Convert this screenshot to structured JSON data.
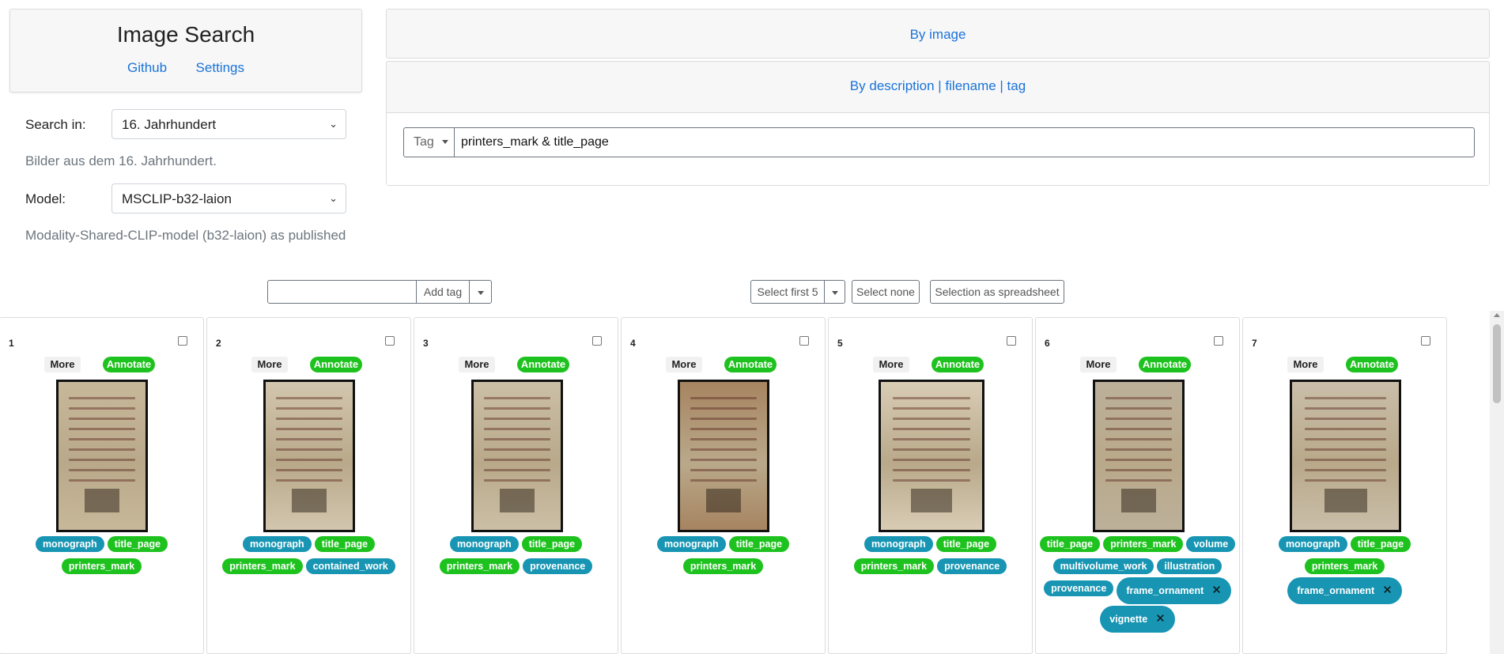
{
  "sidebar": {
    "title": "Image Search",
    "links": [
      "Github",
      "Settings"
    ],
    "search_in_label": "Search in:",
    "search_in_value": "16. Jahrhundert",
    "search_in_desc": "Bilder aus dem 16. Jahrhundert.",
    "model_label": "Model:",
    "model_value": "MSCLIP-b32-laion",
    "model_desc": "Modality-Shared-CLIP-model (b32-laion) as published"
  },
  "search": {
    "by_image": "By image",
    "by_desc": "By description | filename | tag",
    "mode": "Tag",
    "query": "printers_mark & title_page"
  },
  "toolbar": {
    "add_tag": "Add tag",
    "select_first": "Select first 5",
    "select_none": "Select none",
    "spreadsheet": "Selection as spreadsheet"
  },
  "result_buttons": {
    "more": "More",
    "annotate": "Annotate"
  },
  "results": [
    {
      "num": "1",
      "tags": [
        [
          "monograph",
          "t"
        ],
        [
          "title_page",
          "g"
        ],
        [
          "printers_mark",
          "g"
        ]
      ]
    },
    {
      "num": "2",
      "tags": [
        [
          "monograph",
          "t"
        ],
        [
          "title_page",
          "g"
        ],
        [
          "printers_mark",
          "g"
        ],
        [
          "contained_work",
          "t"
        ]
      ]
    },
    {
      "num": "3",
      "tags": [
        [
          "monograph",
          "t"
        ],
        [
          "title_page",
          "g"
        ],
        [
          "printers_mark",
          "g"
        ],
        [
          "provenance",
          "t"
        ]
      ]
    },
    {
      "num": "4",
      "tags": [
        [
          "monograph",
          "t"
        ],
        [
          "title_page",
          "g"
        ],
        [
          "printers_mark",
          "g"
        ]
      ]
    },
    {
      "num": "5",
      "tags": [
        [
          "monograph",
          "t"
        ],
        [
          "title_page",
          "g"
        ],
        [
          "printers_mark",
          "g"
        ],
        [
          "provenance",
          "t"
        ]
      ]
    },
    {
      "num": "6",
      "tags": [
        [
          "title_page",
          "g"
        ],
        [
          "printers_mark",
          "g"
        ],
        [
          "volume",
          "t"
        ],
        [
          "multivolume_work",
          "t"
        ],
        [
          "illustration",
          "t"
        ],
        [
          "provenance",
          "t"
        ],
        [
          "frame_ornament",
          "t",
          "big"
        ],
        [
          "vignette",
          "t",
          "big"
        ]
      ]
    },
    {
      "num": "7",
      "tags": [
        [
          "monograph",
          "t"
        ],
        [
          "title_page",
          "g"
        ],
        [
          "printers_mark",
          "g"
        ],
        [
          "frame_ornament",
          "t",
          "big"
        ]
      ]
    }
  ],
  "colors": {
    "green": "#1ec21e",
    "teal": "#1795b3",
    "link": "#1a73d9"
  }
}
